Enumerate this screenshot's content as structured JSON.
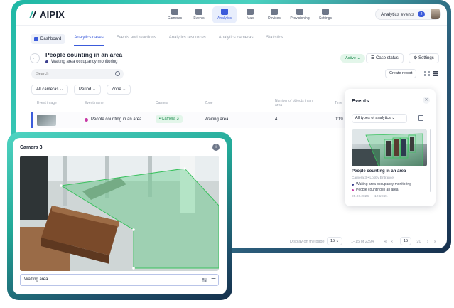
{
  "brand": {
    "name": "AIPIX"
  },
  "nav": [
    {
      "label": "Cameras",
      "icon": "camera-icon"
    },
    {
      "label": "Events",
      "icon": "events-icon"
    },
    {
      "label": "Analytics",
      "icon": "analytics-icon",
      "active": true
    },
    {
      "label": "Map",
      "icon": "map-icon"
    },
    {
      "label": "Devices",
      "icon": "devices-icon"
    },
    {
      "label": "Provisioning",
      "icon": "provisioning-icon"
    },
    {
      "label": "Settings",
      "icon": "settings-icon"
    }
  ],
  "header_right": {
    "events_label": "Analytics events",
    "events_count": "2"
  },
  "tabs": {
    "dashboard": "Dashboard",
    "items": [
      "Analytics cases",
      "Events and reactions",
      "Analytics resources",
      "Analytics cameras",
      "Statistics"
    ],
    "active_index": 0
  },
  "page": {
    "title": "People counting in an area",
    "subtitle": "Waiting area occupancy monitoring",
    "status": "Active",
    "case_status": "Case status",
    "settings": "Settings",
    "create_report": "Create report"
  },
  "search": {
    "placeholder": "Search"
  },
  "filters": [
    "All cameras",
    "Period",
    "Zone"
  ],
  "table": {
    "columns": [
      "Event image",
      "Event name",
      "Camera",
      "Zone",
      "Number of objects in an area",
      "Time"
    ],
    "rows": [
      {
        "name": "People counting in an area",
        "camera": "Camera 3",
        "zone": "Waiting area",
        "count": "4",
        "time": "0:19"
      }
    ]
  },
  "events_panel": {
    "title": "Events",
    "filter": "All types of analytics",
    "event": {
      "name": "People counting in an area",
      "meta": "Camera 3 • Lobby Entrance",
      "line1": "Waiting area occupancy monitoring",
      "line2": "People counting in an area",
      "date": "25.06.2026",
      "time": "12:19:21"
    }
  },
  "pagination": {
    "display_label": "Display on the page",
    "per_page": "15",
    "range": "1–15 of 2394",
    "page": "15",
    "total": "/20"
  },
  "camera_card": {
    "title": "Camera 3",
    "zone_value": "Waiting area"
  },
  "colors": {
    "accent": "#3b5bdb",
    "active_green": "#1a8a4c",
    "zone_green": "#2eae4f",
    "frame_teal": "#22a897"
  }
}
